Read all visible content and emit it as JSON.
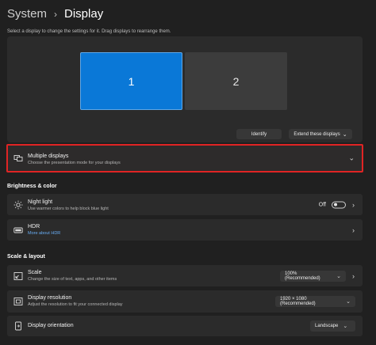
{
  "breadcrumb": {
    "parent": "System",
    "separator": "›",
    "current": "Display"
  },
  "instructions": "Select a display to change the settings for it. Drag displays to rearrange them.",
  "arrangement": {
    "monitors": [
      {
        "label": "1",
        "selected": true,
        "color": "#0a78d7"
      },
      {
        "label": "2",
        "selected": false,
        "color": "#3c3c3c"
      }
    ],
    "identify_label": "Identify",
    "extend_label": "Extend these displays"
  },
  "multiple_displays": {
    "title": "Multiple displays",
    "subtitle": "Choose the presentation mode for your displays",
    "highlight_color": "#e02424"
  },
  "brightness_section": {
    "heading": "Brightness & color",
    "night_light": {
      "title": "Night light",
      "subtitle": "Use warmer colors to help block blue light",
      "state": "Off"
    },
    "hdr": {
      "title": "HDR",
      "link": "More about HDR"
    }
  },
  "scale_section": {
    "heading": "Scale & layout",
    "scale": {
      "title": "Scale",
      "subtitle": "Change the size of text, apps, and other items",
      "value": "100% (Recommended)"
    },
    "resolution": {
      "title": "Display resolution",
      "subtitle": "Adjust the resolution to fit your connected display",
      "value": "1920 × 1080 (Recommended)"
    },
    "orientation": {
      "title": "Display orientation",
      "value": "Landscape"
    }
  }
}
